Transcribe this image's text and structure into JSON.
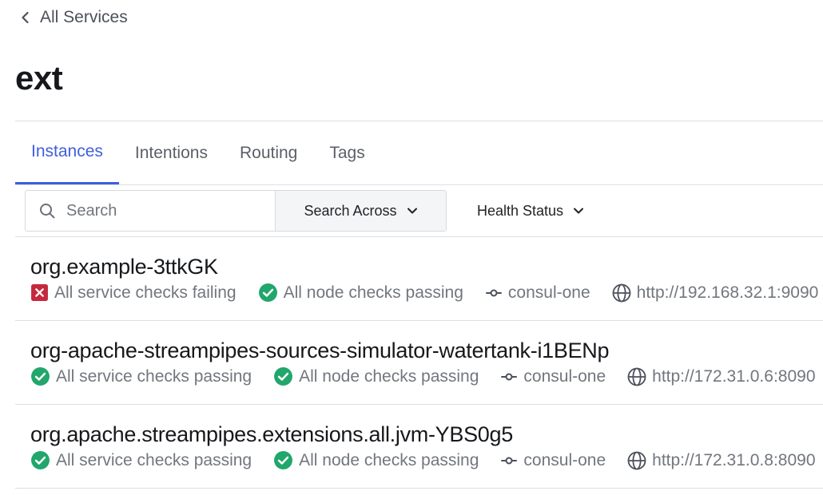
{
  "nav": {
    "back_label": "All Services"
  },
  "page": {
    "title": "ext"
  },
  "tabs": [
    {
      "label": "Instances",
      "active": true
    },
    {
      "label": "Intentions",
      "active": false
    },
    {
      "label": "Routing",
      "active": false
    },
    {
      "label": "Tags",
      "active": false
    }
  ],
  "search": {
    "placeholder": "Search",
    "value": "",
    "across_label": "Search Across"
  },
  "filters": {
    "health_label": "Health Status"
  },
  "colors": {
    "accent": "#3f5fdd",
    "passing": "#21a66b",
    "failing": "#c5283d",
    "muted_text": "#72767e"
  },
  "instances": [
    {
      "name": "org.example-3ttkGK",
      "service_checks": {
        "status": "failing",
        "label": "All service checks failing",
        "icon": "x-square-icon"
      },
      "node_checks": {
        "status": "passing",
        "label": "All node checks passing",
        "icon": "check-circle-icon"
      },
      "node": {
        "label": "consul-one",
        "icon": "git-commit-icon"
      },
      "address": {
        "label": "http://192.168.32.1:9090",
        "icon": "globe-icon"
      }
    },
    {
      "name": "org-apache-streampipes-sources-simulator-watertank-i1BENp",
      "service_checks": {
        "status": "passing",
        "label": "All service checks passing",
        "icon": "check-circle-icon"
      },
      "node_checks": {
        "status": "passing",
        "label": "All node checks passing",
        "icon": "check-circle-icon"
      },
      "node": {
        "label": "consul-one",
        "icon": "git-commit-icon"
      },
      "address": {
        "label": "http://172.31.0.6:8090",
        "icon": "globe-icon"
      }
    },
    {
      "name": "org.apache.streampipes.extensions.all.jvm-YBS0g5",
      "service_checks": {
        "status": "passing",
        "label": "All service checks passing",
        "icon": "check-circle-icon"
      },
      "node_checks": {
        "status": "passing",
        "label": "All node checks passing",
        "icon": "check-circle-icon"
      },
      "node": {
        "label": "consul-one",
        "icon": "git-commit-icon"
      },
      "address": {
        "label": "http://172.31.0.8:8090",
        "icon": "globe-icon"
      }
    }
  ]
}
